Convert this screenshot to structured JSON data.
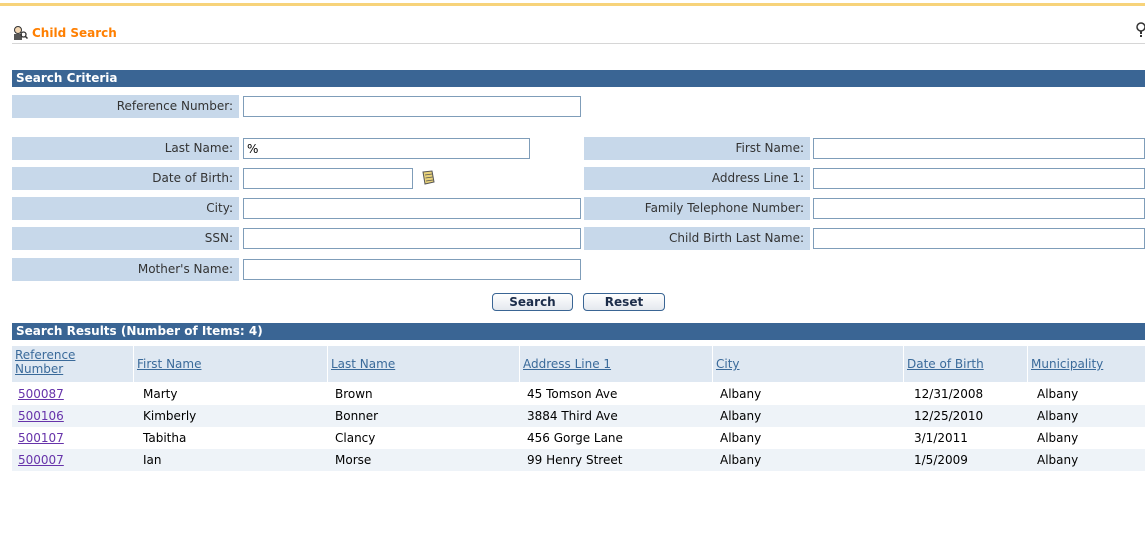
{
  "header": {
    "title": "Child Search"
  },
  "criteria": {
    "section_title": "Search Criteria",
    "reference_number": {
      "label": "Reference Number:",
      "value": ""
    },
    "last_name": {
      "label": "Last Name:",
      "value": "%"
    },
    "first_name": {
      "label": "First Name:",
      "value": ""
    },
    "date_of_birth": {
      "label": "Date of Birth:",
      "value": ""
    },
    "address_line_1": {
      "label": "Address Line 1:",
      "value": ""
    },
    "city": {
      "label": "City:",
      "value": ""
    },
    "family_telephone": {
      "label": "Family Telephone Number:",
      "value": ""
    },
    "ssn": {
      "label": "SSN:",
      "value": ""
    },
    "child_birth_last_name": {
      "label": "Child Birth Last Name:",
      "value": ""
    },
    "mothers_name": {
      "label": "Mother's Name:",
      "value": ""
    },
    "search_button": "Search",
    "reset_button": "Reset"
  },
  "results": {
    "section_title": "Search Results (Number of Items: 4)",
    "columns": [
      "Reference Number",
      "First Name",
      "Last Name",
      "Address Line 1",
      "City",
      "Date of Birth",
      "Municipality"
    ],
    "rows": [
      [
        "500087",
        "Marty",
        "Brown",
        "45 Tomson Ave",
        "Albany",
        "12/31/2008",
        "Albany"
      ],
      [
        "500106",
        "Kimberly",
        "Bonner",
        "3884 Third Ave",
        "Albany",
        "12/25/2010",
        "Albany"
      ],
      [
        "500107",
        "Tabitha",
        "Clancy",
        "456 Gorge Lane",
        "Albany",
        "3/1/2011",
        "Albany"
      ],
      [
        "500007",
        "Ian",
        "Morse",
        "99 Henry Street",
        "Albany",
        "1/5/2009",
        "Albany"
      ]
    ]
  },
  "icons": [
    "child-search-icon",
    "help-icon",
    "calendar-icon"
  ],
  "colors": {
    "accent": "#ff7f00",
    "section_bar": "#3a6594",
    "label_bg": "#c7d8ea",
    "link": "#6633aa"
  }
}
